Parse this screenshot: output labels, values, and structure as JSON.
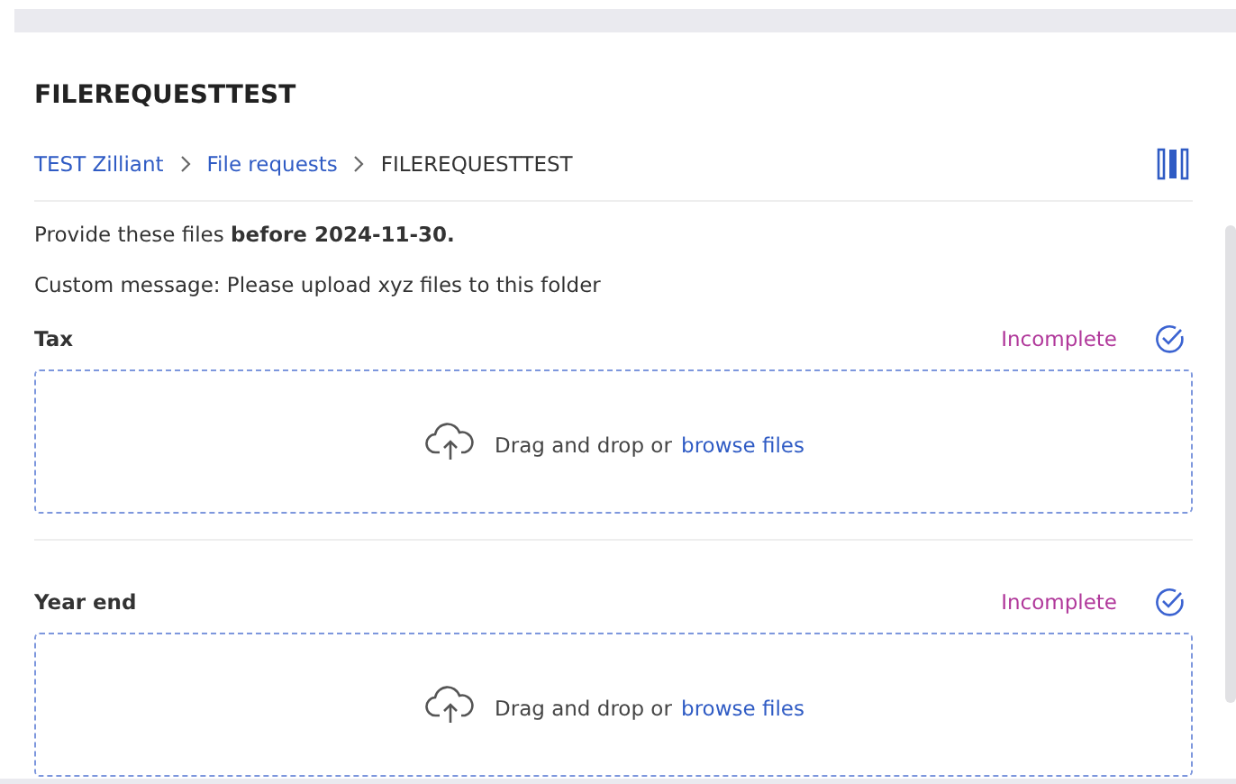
{
  "title": "FILEREQUESTTEST",
  "breadcrumb": [
    {
      "label": "TEST Zilliant",
      "kind": "link"
    },
    {
      "label": "File requests",
      "kind": "link"
    },
    {
      "label": "FILEREQUESTTEST",
      "kind": "current"
    }
  ],
  "deadline": "Provide these files **before 2024-11-30.**",
  "message": "Custom message: Please upload xyz files to this folder",
  "requests": [
    {
      "name": "Tax",
      "status": "Incomplete",
      "dropzone": {
        "text": "Drag and drop or",
        "link": "browse files"
      }
    },
    {
      "name": "Year end",
      "status": "Incomplete",
      "dropzone": {
        "text": "Drag and drop or",
        "link": "browse files"
      }
    }
  ]
}
